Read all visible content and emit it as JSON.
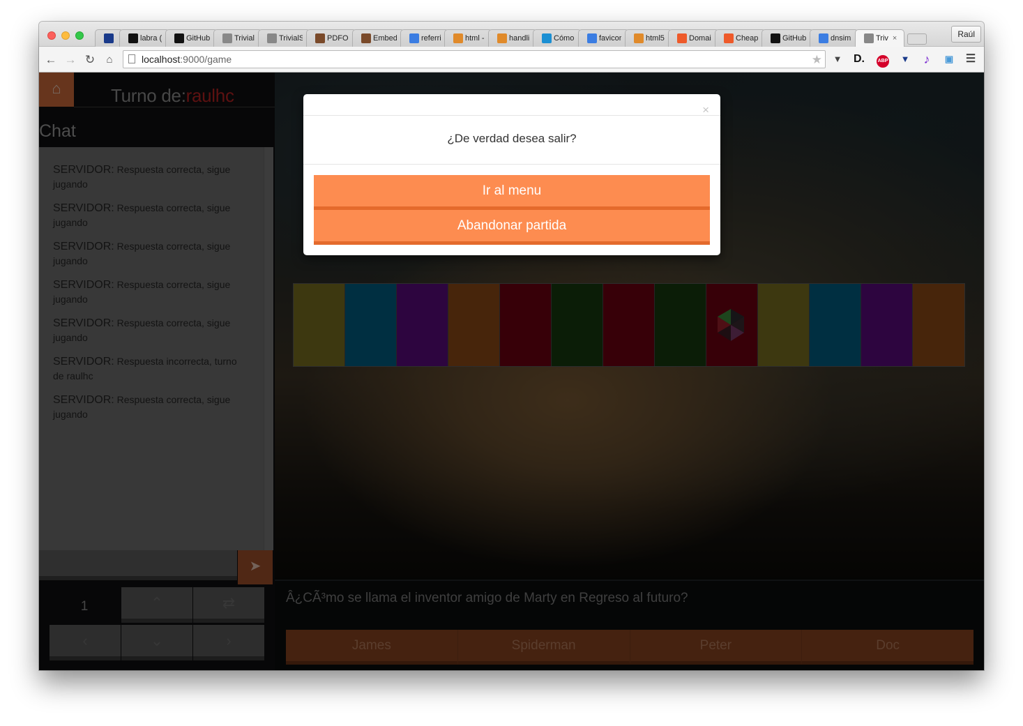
{
  "browser": {
    "profile": "Raúl",
    "url_host": "localhost",
    "url_path": ":9000/game",
    "tabs": [
      {
        "label": "",
        "icon": "vivaldi-icon",
        "color": "#1a3a8a"
      },
      {
        "label": "labra (",
        "icon": "github-icon",
        "color": "#111111"
      },
      {
        "label": "GitHub",
        "icon": "github-icon",
        "color": "#111111"
      },
      {
        "label": "Trivial",
        "icon": "page-icon",
        "color": "#888888"
      },
      {
        "label": "TrivialS",
        "icon": "page-icon",
        "color": "#888888"
      },
      {
        "label": "PDFO",
        "icon": "avatar-icon",
        "color": "#7a4a2a"
      },
      {
        "label": "Embed",
        "icon": "avatar-icon",
        "color": "#7a4a2a"
      },
      {
        "label": "referri",
        "icon": "google-icon",
        "color": "#3b7de2"
      },
      {
        "label": "html -",
        "icon": "stackoverflow-icon",
        "color": "#e08a2a"
      },
      {
        "label": "handli",
        "icon": "stackoverflow-icon",
        "color": "#e08a2a"
      },
      {
        "label": "Cómo",
        "icon": "chat-icon",
        "color": "#1b8fd3"
      },
      {
        "label": "favicor",
        "icon": "google-icon",
        "color": "#3b7de2"
      },
      {
        "label": "html5",
        "icon": "stackoverflow-icon",
        "color": "#e08a2a"
      },
      {
        "label": "Domai",
        "icon": "namecheap-icon",
        "color": "#ee5a2a"
      },
      {
        "label": "Cheap",
        "icon": "namecheap-icon",
        "color": "#ee5a2a"
      },
      {
        "label": "GitHub",
        "icon": "github-icon",
        "color": "#111111"
      },
      {
        "label": "dnsim",
        "icon": "google-icon",
        "color": "#3b7de2"
      },
      {
        "label": "Triv",
        "icon": "page-icon",
        "color": "#888888",
        "active": true
      }
    ]
  },
  "header": {
    "turn_label": "Turno de:",
    "turn_player": "raulhc"
  },
  "chat": {
    "title": "Chat",
    "messages": [
      {
        "sender": "SERVIDOR:",
        "text": "Respuesta correcta, sigue jugando"
      },
      {
        "sender": "SERVIDOR:",
        "text": "Respuesta correcta, sigue jugando"
      },
      {
        "sender": "SERVIDOR:",
        "text": "Respuesta correcta, sigue jugando"
      },
      {
        "sender": "SERVIDOR:",
        "text": "Respuesta correcta, sigue jugando"
      },
      {
        "sender": "SERVIDOR:",
        "text": "Respuesta correcta, sigue jugando"
      },
      {
        "sender": "SERVIDOR:",
        "text": "Respuesta incorrecta, turno de raulhc"
      },
      {
        "sender": "SERVIDOR:",
        "text": "Respuesta correcta, sigue jugando"
      }
    ]
  },
  "controls": {
    "turn_count": "1"
  },
  "board": {
    "cells": [
      "#7a7020",
      "#005f83",
      "#5a0a7f",
      "#8e4a17",
      "#6f0010",
      "#163a0e",
      "#6f0010",
      "#163a0e",
      "#6f0010",
      "#7a7020",
      "#005f83",
      "#5a0a7f",
      "#8e4a17"
    ],
    "token_cell": 8
  },
  "question": {
    "text": "Â¿CÃ³mo se llama el inventor amigo de Marty en Regreso al futuro?",
    "answers": [
      "James",
      "Spiderman",
      "Peter",
      "Doc"
    ]
  },
  "modal": {
    "close": "×",
    "message": "¿De verdad desea salir?",
    "button_menu": "Ir al menu",
    "button_abandon": "Abandonar partida"
  },
  "colors": {
    "accent": "#fd8c50",
    "player": "#b82323"
  }
}
